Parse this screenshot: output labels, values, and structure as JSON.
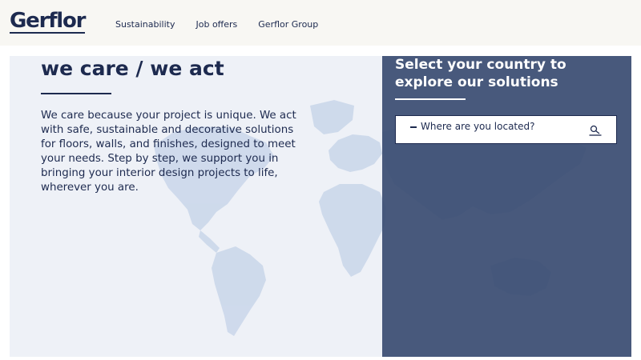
{
  "header": {
    "logo_text": "Gerflor",
    "nav": [
      {
        "label": "Sustainability"
      },
      {
        "label": "Job offers"
      },
      {
        "label": "Gerflor Group"
      }
    ]
  },
  "hero": {
    "headline": "we care / we act",
    "body": "We care because your project is unique. We act with safe, sustainable and decorative solutions for floors, walls, and finishes, designed to meet your needs. Step by step, we support you in bringing your interior design projects to life, wherever you are."
  },
  "country_panel": {
    "title": "Select your country to explore our solutions",
    "location_label": "Where are you located?",
    "location_icon": "location-pin-icon"
  },
  "colors": {
    "brand_navy": "#1d2a4f",
    "panel_bg": "#3a4c71",
    "topbar_bg": "#f8f7f3",
    "hero_bg": "#eef1f7"
  }
}
